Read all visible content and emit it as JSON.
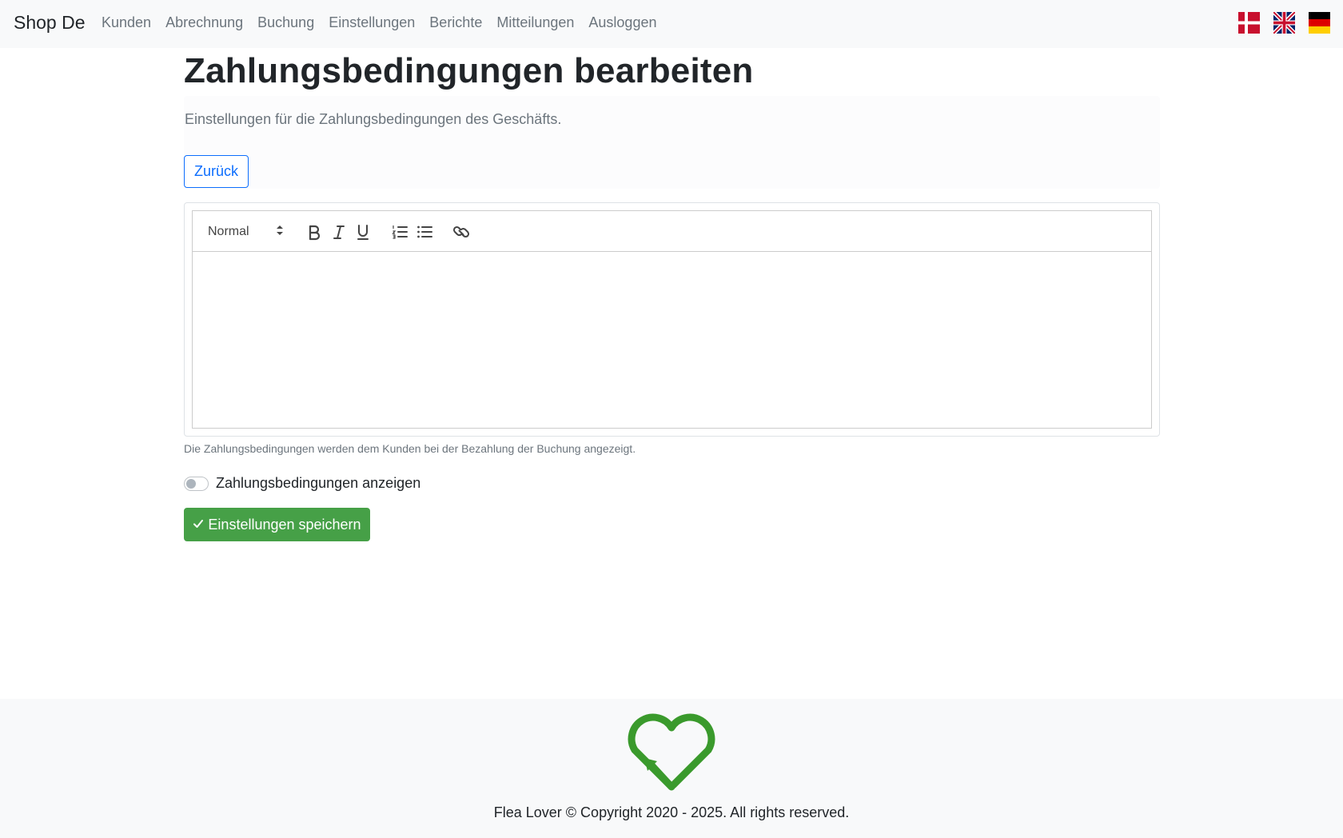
{
  "navbar": {
    "brand": "Shop De",
    "links": [
      "Kunden",
      "Abrechnung",
      "Buchung",
      "Einstellungen",
      "Berichte",
      "Mitteilungen",
      "Ausloggen"
    ],
    "flags": [
      "danish-flag-icon",
      "uk-flag-icon",
      "german-flag-icon"
    ]
  },
  "page": {
    "title": "Zahlungsbedingungen bearbeiten",
    "lead": "Einstellungen für die Zahlungsbedingungen des Geschäfts.",
    "back_label": "Zurück"
  },
  "editor": {
    "format_select": "Normal",
    "toolbar_icons": [
      "bold-icon",
      "italic-icon",
      "underline-icon",
      "ordered-list-icon",
      "bullet-list-icon",
      "link-icon"
    ],
    "content": ""
  },
  "form": {
    "help_text": "Die Zahlungsbedingungen werden dem Kunden bei der Bezahlung der Buchung angezeigt.",
    "toggle_label": "Zahlungsbedingungen anzeigen",
    "toggle_checked": false,
    "save_label": "Einstellungen speichern"
  },
  "footer": {
    "copyright": "Flea Lover © Copyright 2020 - 2025. All rights reserved."
  },
  "colors": {
    "primary": "#0d6efd",
    "success": "#46a047",
    "logo_green": "#3a9a2c",
    "muted": "#6c757d"
  }
}
